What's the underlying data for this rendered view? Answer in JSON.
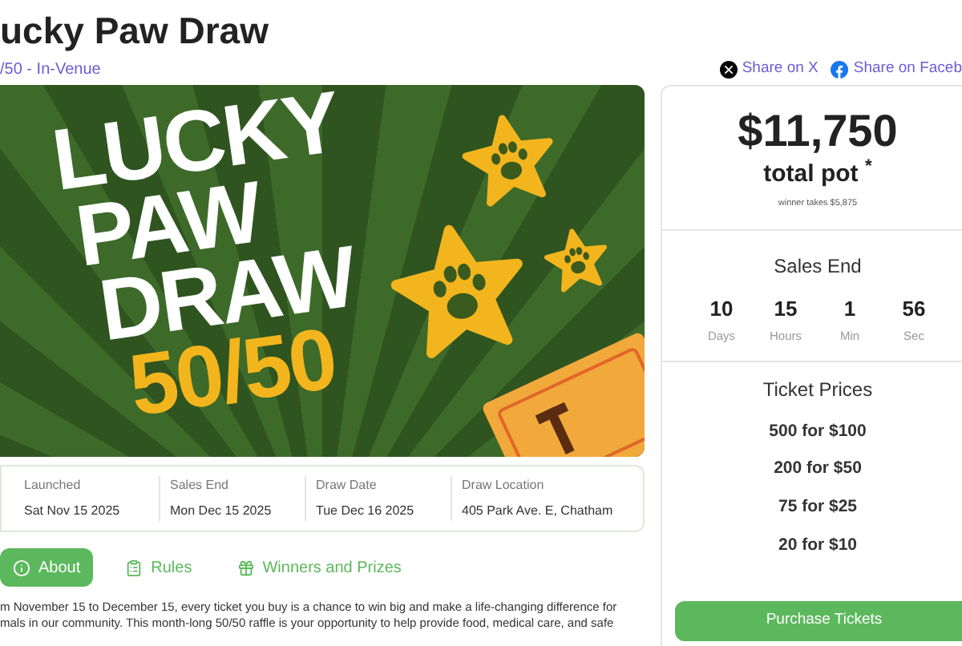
{
  "title": "ucky Paw Draw",
  "subtitle": "/50 - In-Venue",
  "share": [
    {
      "kind": "x",
      "label": "Share on X"
    },
    {
      "kind": "facebook",
      "label": "Share on Faceb"
    }
  ],
  "banner": {
    "lines": [
      "LUCKY",
      "PAW",
      "DRAW"
    ],
    "accent": "50/50"
  },
  "details": [
    {
      "label": "Launched",
      "value": "Sat Nov 15 2025"
    },
    {
      "label": "Sales End",
      "value": "Mon Dec 15 2025"
    },
    {
      "label": "Draw Date",
      "value": "Tue Dec 16 2025"
    },
    {
      "label": "Draw Location",
      "value": "405 Park Ave. E, Chatham"
    }
  ],
  "tabs": [
    {
      "kind": "info",
      "label": "About",
      "selected": true
    },
    {
      "kind": "rules",
      "label": "Rules",
      "selected": false
    },
    {
      "kind": "prizes",
      "label": "Winners and Prizes",
      "selected": false
    }
  ],
  "about": [
    "m November 15 to December 15, every ticket you buy is a chance to win big and make a life-changing difference for",
    "mals in our community. This month-long 50/50 raffle is your opportunity to help provide food, medical care, and safe"
  ],
  "pot": {
    "amount": "$11,750",
    "label": "total pot $^{*}$",
    "note": "winner takes $5,875"
  },
  "sales_end": {
    "title": "Sales End",
    "countdown": [
      {
        "value": "10",
        "unit": "Days"
      },
      {
        "value": "15",
        "unit": "Hours"
      },
      {
        "value": "1",
        "unit": "Min"
      },
      {
        "value": "56",
        "unit": "Sec"
      }
    ]
  },
  "ticket_prices": {
    "title": "Ticket Prices",
    "items": [
      "500 for $100",
      "200 for $50",
      "75 for $25",
      "20 for $10"
    ]
  },
  "purchase_button": "Purchase Tickets"
}
